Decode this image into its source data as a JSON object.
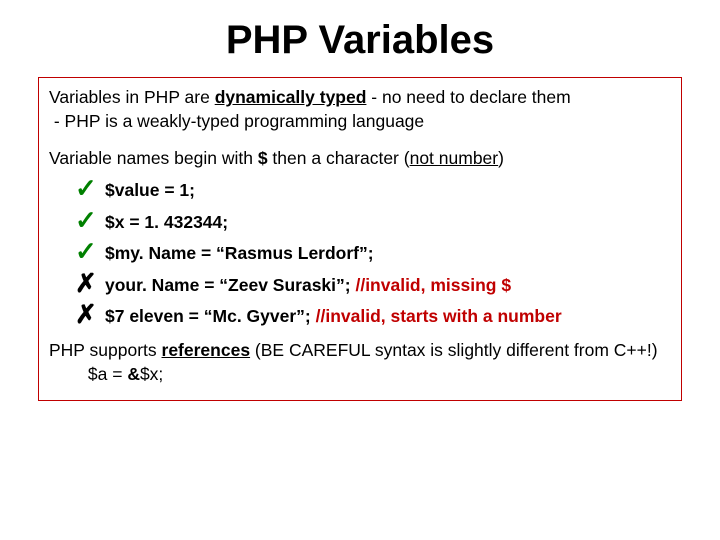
{
  "title": "PHP Variables",
  "p1_a": "Variables in PHP are ",
  "p1_u": "dynamically typed",
  "p1_b": " - no need to declare them",
  "p1_c": " - PHP is a weakly-typed programming language",
  "p2_a": "Variable names begin with ",
  "p2_b": "$",
  "p2_c": " then a character (",
  "p2_u": "not number",
  "p2_d": ")",
  "items": [
    {
      "mark": "✓",
      "ok": true,
      "t": "$value = 1;"
    },
    {
      "mark": "✓",
      "ok": true,
      "t": "$x = 1. 432344;"
    },
    {
      "mark": "✓",
      "ok": true,
      "t": "$my. Name = “Rasmus Lerdorf”;"
    },
    {
      "mark": "✗",
      "ok": false,
      "t_a": "your. Name = “Zeev Suraski”; ",
      "t_b": "//invalid, missing $"
    },
    {
      "mark": "✗",
      "ok": false,
      "t_a": "$7 eleven = “Mc. Gyver”; ",
      "t_b": "//invalid, starts with a number"
    }
  ],
  "p3_a": "PHP supports ",
  "p3_u": "references",
  "p3_b": " (BE CAREFUL syntax is slightly different from C++!)",
  "p3_c": "        $a = ",
  "p3_d": "&",
  "p3_e": "$x;"
}
